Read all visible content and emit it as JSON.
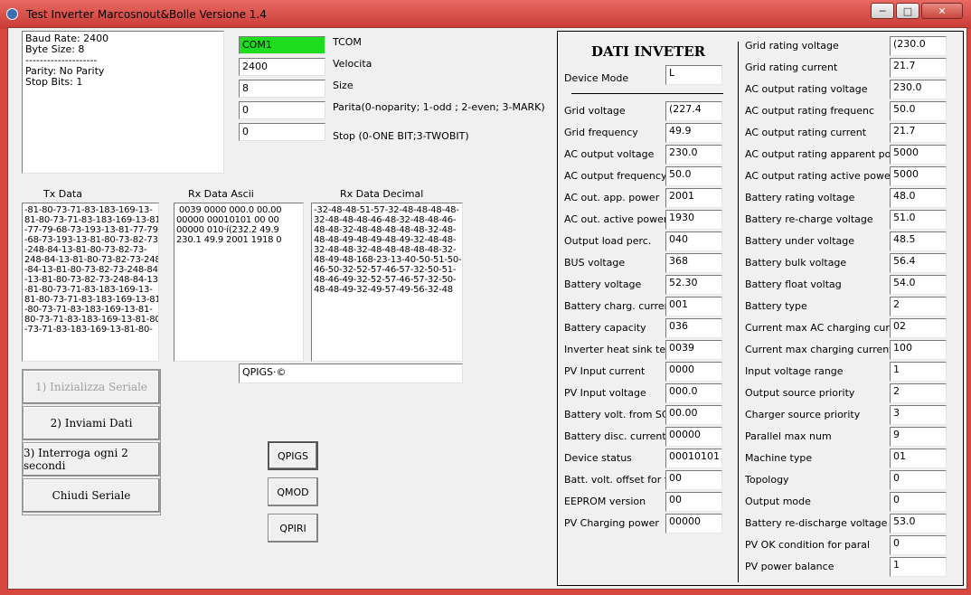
{
  "window": {
    "title": "Test Inverter Marcosnout&Bolle  Versione 1.4"
  },
  "serial_info": {
    "line1": "Baud Rate: 2400",
    "line2": "Byte Size: 8",
    "separator": "----------------------",
    "line3": "Parity: No Parity",
    "line4": "Stop Bits: 1"
  },
  "settings": [
    {
      "value": "COM1",
      "label": "TCOM",
      "color": "#1edc1e"
    },
    {
      "value": "2400",
      "label": "Velocita"
    },
    {
      "value": "8",
      "label": "Size"
    },
    {
      "value": "0",
      "label": "Parita(0-noparity; 1-odd ; 2-even; 3-MARK)"
    },
    {
      "value": "0",
      "label": "Stop (0-ONE BIT;3-TWOBIT)"
    }
  ],
  "columns": {
    "tx": "Tx Data",
    "rx_ascii": "Rx Data Ascii",
    "rx_decimal": "Rx Data Decimal"
  },
  "tx_data": "-81-80-73-71-83-183-169-13-\n81-80-73-71-83-183-169-13-81\n-77-79-68-73-193-13-81-77-79\n-68-73-193-13-81-80-73-82-73\n-248-84-13-81-80-73-82-73-\n248-84-13-81-80-73-82-73-248\n-84-13-81-80-73-82-73-248-84\n-13-81-80-73-82-73-248-84-13\n-81-80-73-71-83-183-169-13-\n81-80-73-71-83-183-169-13-81\n-80-73-71-83-183-169-13-81-\n80-73-71-83-183-169-13-81-80\n-73-71-83-183-169-13-81-80-",
  "rx_ascii": " 0039 0000 000.0 00.00\n00000 00010101 00 00\n00000 010·í(232.2 49.9\n230.1 49.9 2001 1918 0",
  "rx_decimal": "-32-48-48-51-57-32-48-48-48-48-\n32-48-48-48-46-48-32-48-48-46-\n48-48-32-48-48-48-48-48-32-48-\n48-48-49-48-49-48-49-32-48-48-\n32-48-48-32-48-48-48-48-48-32-\n48-49-48-168-23-13-40-50-51-50-\n46-50-32-52-57-46-57-32-50-51-\n48-46-49-32-52-57-46-57-32-50-\n48-48-49-32-49-57-49-56-32-48",
  "command_field": "QPIGS·©",
  "actions": [
    "1) Inizializza Seriale",
    "2) Inviami Dati",
    "3) Interroga ogni 2 secondi",
    "Chiudi Seriale"
  ],
  "commands": [
    "QPIGS",
    "QMOD",
    "QPIRI"
  ],
  "dati": {
    "heading": "DATI INVETER",
    "device_mode_label": "Device Mode",
    "device_mode_value": "L",
    "left": [
      {
        "label": "Grid voltage",
        "value": "(227.4"
      },
      {
        "label": "Grid frequency",
        "value": "49.9"
      },
      {
        "label": "AC output voltage",
        "value": "230.0"
      },
      {
        "label": "AC output frequency",
        "value": "50.0"
      },
      {
        "label": "AC out. app. power",
        "value": "2001"
      },
      {
        "label": "AC out. active power",
        "value": "1930"
      },
      {
        "label": "Output load perc.",
        "value": "040"
      },
      {
        "label": "BUS voltage",
        "value": "368"
      },
      {
        "label": "Battery voltage",
        "value": "52.30"
      },
      {
        "label": "Battery charg. current",
        "value": "001"
      },
      {
        "label": "Battery capacity",
        "value": "036"
      },
      {
        "label": "Inverter heat sink temp.",
        "value": "0039"
      },
      {
        "label": "PV Input current",
        "value": "0000"
      },
      {
        "label": "PV Input voltage",
        "value": "000.0"
      },
      {
        "label": "Battery volt. from SC",
        "value": "00.00"
      },
      {
        "label": "Battery disc. current",
        "value": "00000"
      },
      {
        "label": "Device status",
        "value": "00010101"
      },
      {
        "label": "Batt. volt. offset for fans",
        "value": "00"
      },
      {
        "label": "EEPROM version",
        "value": "00"
      },
      {
        "label": "PV Charging power",
        "value": "00000"
      }
    ],
    "right": [
      {
        "label": "Grid rating voltage",
        "value": "(230.0"
      },
      {
        "label": "Grid rating current",
        "value": "21.7"
      },
      {
        "label": "AC output rating voltage",
        "value": "230.0"
      },
      {
        "label": "AC output rating frequenc",
        "value": "50.0"
      },
      {
        "label": "AC output rating current",
        "value": "21.7"
      },
      {
        "label": "AC output rating apparent power",
        "value": "5000"
      },
      {
        "label": "AC output rating active power",
        "value": "5000"
      },
      {
        "label": "Battery rating voltage",
        "value": "48.0"
      },
      {
        "label": "Battery re-charge voltage",
        "value": "51.0"
      },
      {
        "label": "Battery under voltage",
        "value": "48.5"
      },
      {
        "label": "Battery bulk voltage",
        "value": "56.4"
      },
      {
        "label": "Battery float voltag",
        "value": "54.0"
      },
      {
        "label": "Battery type",
        "value": "2"
      },
      {
        "label": "Current max AC charging current",
        "value": "02"
      },
      {
        "label": "Current max charging current",
        "value": "100"
      },
      {
        "label": "Input voltage range",
        "value": "1"
      },
      {
        "label": "Output source priority",
        "value": "2"
      },
      {
        "label": "Charger source priority",
        "value": "3"
      },
      {
        "label": "Parallel max num",
        "value": "9"
      },
      {
        "label": "Machine type",
        "value": "01"
      },
      {
        "label": "Topology",
        "value": "0"
      },
      {
        "label": "Output mode",
        "value": "0"
      },
      {
        "label": "Battery re-discharge voltage",
        "value": "53.0"
      },
      {
        "label": "PV OK condition for paral",
        "value": "0"
      },
      {
        "label": "PV power balance",
        "value": "1"
      }
    ]
  }
}
